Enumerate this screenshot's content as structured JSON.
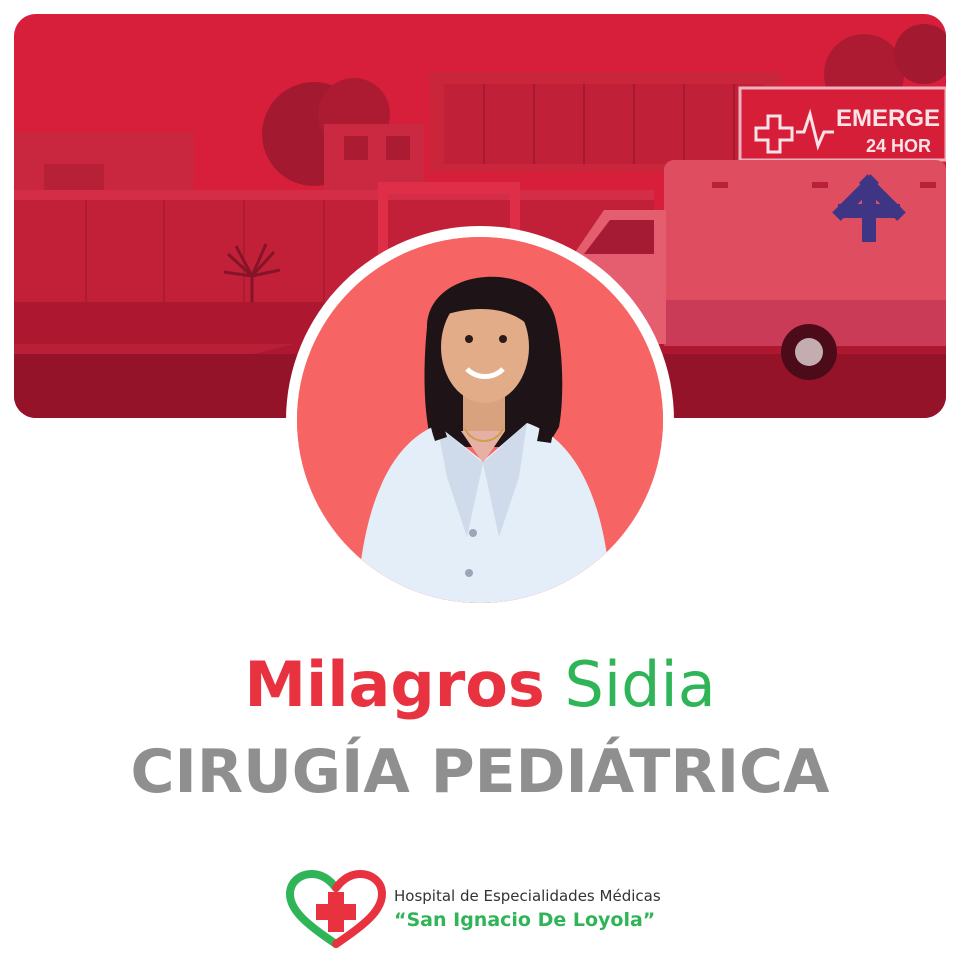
{
  "banner": {
    "emergency_sign_title": "EMERGE",
    "emergency_sign_hours": "24 HOR",
    "tint_color": "#d81b38"
  },
  "doctor": {
    "first_name": "Milagros",
    "last_name": "Sidia",
    "specialty": "CIRUGÍA PEDIÁTRICA"
  },
  "hospital": {
    "line1": "Hospital de Especialidades Médicas",
    "line2": "“San Ignacio De Loyola”",
    "logo_icon": "heart-cross-icon"
  },
  "colors": {
    "first_name": "#e8323f",
    "last_name": "#2fb557",
    "specialty": "#8f8f8f",
    "avatar_background": "#f76464"
  }
}
